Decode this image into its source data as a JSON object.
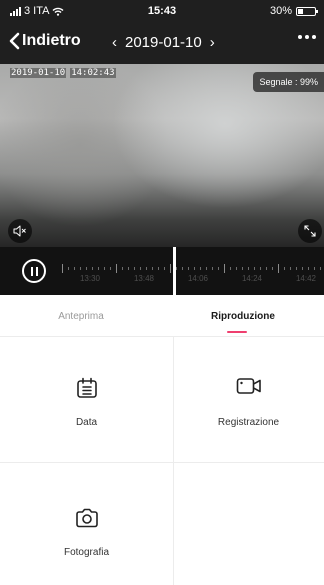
{
  "status_bar": {
    "carrier": "3 ITA",
    "time": "15:43",
    "battery_text": "30%",
    "battery_level": 0.3
  },
  "nav": {
    "back_label": "Indietro",
    "prev_arrow": "‹",
    "date": "2019-01-10",
    "next_arrow": "›"
  },
  "video": {
    "timestamp_date": "2019-01-10",
    "timestamp_time": "14:02:43",
    "signal_label": "Segnale : 99%"
  },
  "timeline": {
    "labels": [
      "13:30",
      "13:48",
      "14:06",
      "14:24",
      "14:42"
    ]
  },
  "tabs": {
    "preview": "Anteprima",
    "playback": "Riproduzione",
    "active": "playback",
    "accent": "#ef3f6f"
  },
  "functions": {
    "date_label": "Data",
    "recording_label": "Registrazione",
    "photo_label": "Fotografia"
  },
  "icons": {
    "signal": "cellular-signal-icon",
    "wifi": "wifi-icon",
    "battery": "battery-icon",
    "back": "chevron-left-icon",
    "more": "more-dots-icon",
    "mute": "speaker-muted-icon",
    "fullscreen": "fullscreen-icon",
    "pause": "pause-icon",
    "calendar": "calendar-icon",
    "record": "video-camera-icon",
    "photo": "camera-icon"
  }
}
